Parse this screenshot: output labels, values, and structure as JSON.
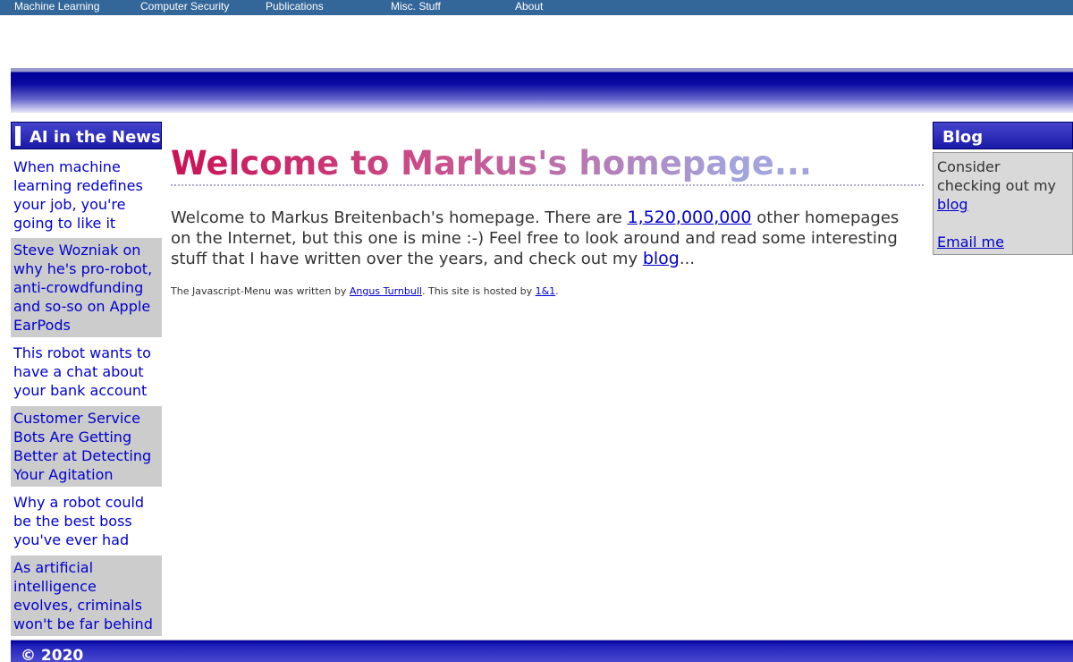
{
  "nav": {
    "items": [
      "Machine Learning",
      "Computer Security",
      "Publications",
      "Misc. Stuff",
      "About"
    ]
  },
  "left_sidebar": {
    "title": "AI in the News",
    "items": [
      {
        "label": "When machine learning redefines your job, you're going to like it"
      },
      {
        "label": "Steve Wozniak on why he's pro-robot, anti-crowdfunding and so-so on Apple EarPods"
      },
      {
        "label": "This robot wants to have a chat about your bank account"
      },
      {
        "label": "Customer Service Bots Are Getting Better at Detecting Your Agitation"
      },
      {
        "label": "Why a robot could be the best boss you've ever had"
      },
      {
        "label": "As artificial intelligence evolves, criminals won't be far behind"
      }
    ]
  },
  "main": {
    "heading": "Welcome to Markus's homepage...",
    "intro_part1": "Welcome to Markus Breitenbach's homepage. There are ",
    "homepages_count_link": "1,520,000,000",
    "intro_part2": " other homepages on the Internet, but this one is mine :-) Feel free to look around and read some interesting stuff that I have written over the years, and check out my ",
    "blog_link": "blog",
    "intro_part3": "...",
    "footnote_part1": "The Javascript-Menu was written by ",
    "menu_author_link": "Angus Turnbull",
    "footnote_part2": ". This site is hosted by ",
    "host_link": "1&1",
    "footnote_part3": "."
  },
  "right_sidebar": {
    "title": "Blog",
    "text": "Consider checking out my ",
    "blog_link": "blog",
    "email_link": "Email me"
  },
  "footer": {
    "copyright": "© 2020"
  },
  "colors": {
    "nav_background": "#336699",
    "link": "#0000cc",
    "banner_dark": "#000099",
    "shaded_item": "#cccccc"
  }
}
